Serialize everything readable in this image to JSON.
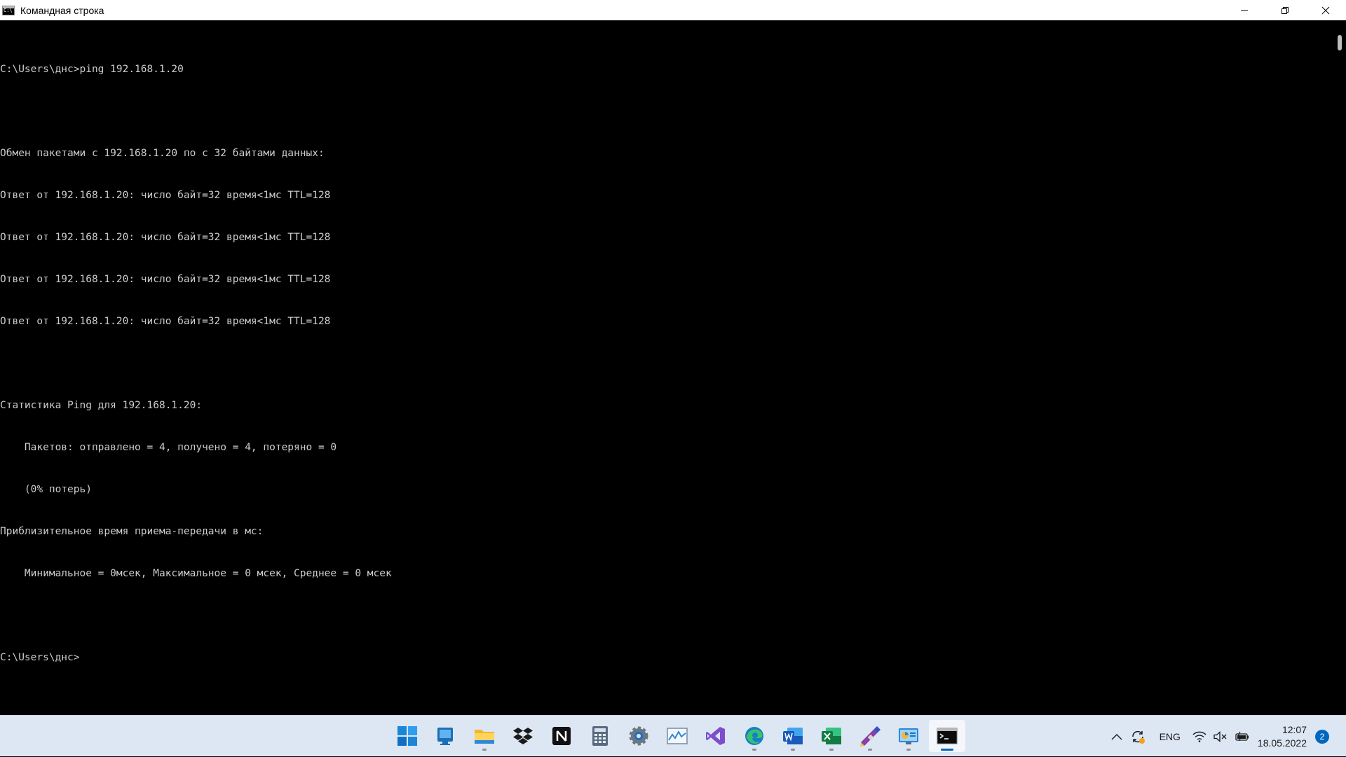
{
  "window": {
    "title": "Командная строка"
  },
  "console": {
    "lines": [
      "C:\\Users\\днс>ping 192.168.1.20",
      "",
      "Обмен пакетами с 192.168.1.20 по с 32 байтами данных:",
      "Ответ от 192.168.1.20: число байт=32 время<1мс TTL=128",
      "Ответ от 192.168.1.20: число байт=32 время<1мс TTL=128",
      "Ответ от 192.168.1.20: число байт=32 время<1мс TTL=128",
      "Ответ от 192.168.1.20: число байт=32 время<1мс TTL=128",
      "",
      "Статистика Ping для 192.168.1.20:",
      "    Пакетов: отправлено = 4, получено = 4, потеряно = 0",
      "    (0% потерь)",
      "Приблизительное время приема-передачи в мс:",
      "    Минимальное = 0мсек, Максимальное = 0 мсек, Среднее = 0 мсек",
      "",
      "C:\\Users\\днс>"
    ]
  },
  "taskbar": {
    "apps": [
      {
        "icon": "start-icon",
        "running": false,
        "active": false
      },
      {
        "icon": "store-icon",
        "running": false,
        "active": false
      },
      {
        "icon": "file-explorer-icon",
        "running": true,
        "active": false
      },
      {
        "icon": "dropbox-icon",
        "running": false,
        "active": false
      },
      {
        "icon": "notion-icon",
        "running": false,
        "active": false
      },
      {
        "icon": "calculator-icon",
        "running": false,
        "active": false
      },
      {
        "icon": "settings-icon",
        "running": false,
        "active": false
      },
      {
        "icon": "performance-monitor-icon",
        "running": false,
        "active": false
      },
      {
        "icon": "visual-studio-icon",
        "running": false,
        "active": false
      },
      {
        "icon": "edge-icon",
        "running": true,
        "active": false
      },
      {
        "icon": "word-icon",
        "running": true,
        "active": false
      },
      {
        "icon": "excel-icon",
        "running": true,
        "active": false
      },
      {
        "icon": "drawing-tool-icon",
        "running": true,
        "active": false
      },
      {
        "icon": "control-panel-icon",
        "running": true,
        "active": false
      },
      {
        "icon": "command-prompt-icon",
        "running": true,
        "active": true
      }
    ],
    "tray": {
      "language": "ENG",
      "time": "12:07",
      "date": "18.05.2022",
      "notifications": "2"
    }
  },
  "colors": {
    "console_bg": "#000000",
    "console_text": "#cccccc",
    "taskbar_bg": "#dde6f3",
    "accent": "#0067c0"
  }
}
